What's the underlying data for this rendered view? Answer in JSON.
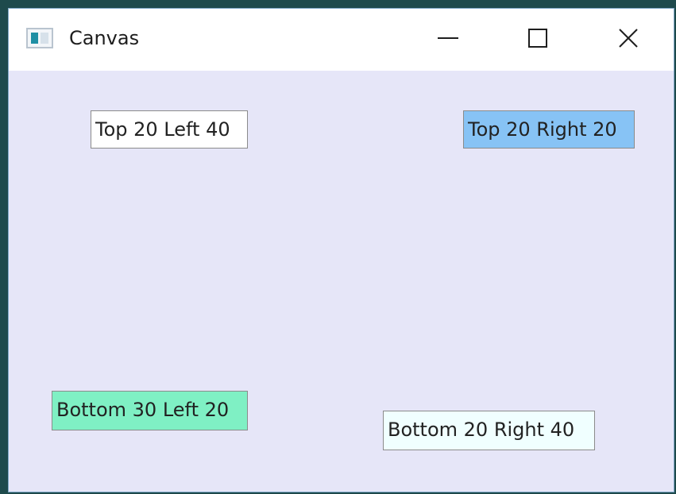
{
  "window": {
    "title": "Canvas",
    "icon": "app-window-icon",
    "controls": {
      "minimize_icon": "minimize-icon",
      "maximize_icon": "maximize-icon",
      "close_icon": "close-icon"
    }
  },
  "colors": {
    "desktop": "#1e4a4c",
    "canvas_background": "#e6e6f8",
    "top_left_bg": "#ffffff",
    "top_right_bg": "#87c3f5",
    "bottom_left_bg": "#7ff0c4",
    "bottom_right_bg": "#f0ffff"
  },
  "labels": {
    "top_left": "Top 20 Left 40",
    "top_right": "Top 20 Right 20",
    "bottom_left": "Bottom 30 Left 20",
    "bottom_right": "Bottom 20 Right 40"
  }
}
